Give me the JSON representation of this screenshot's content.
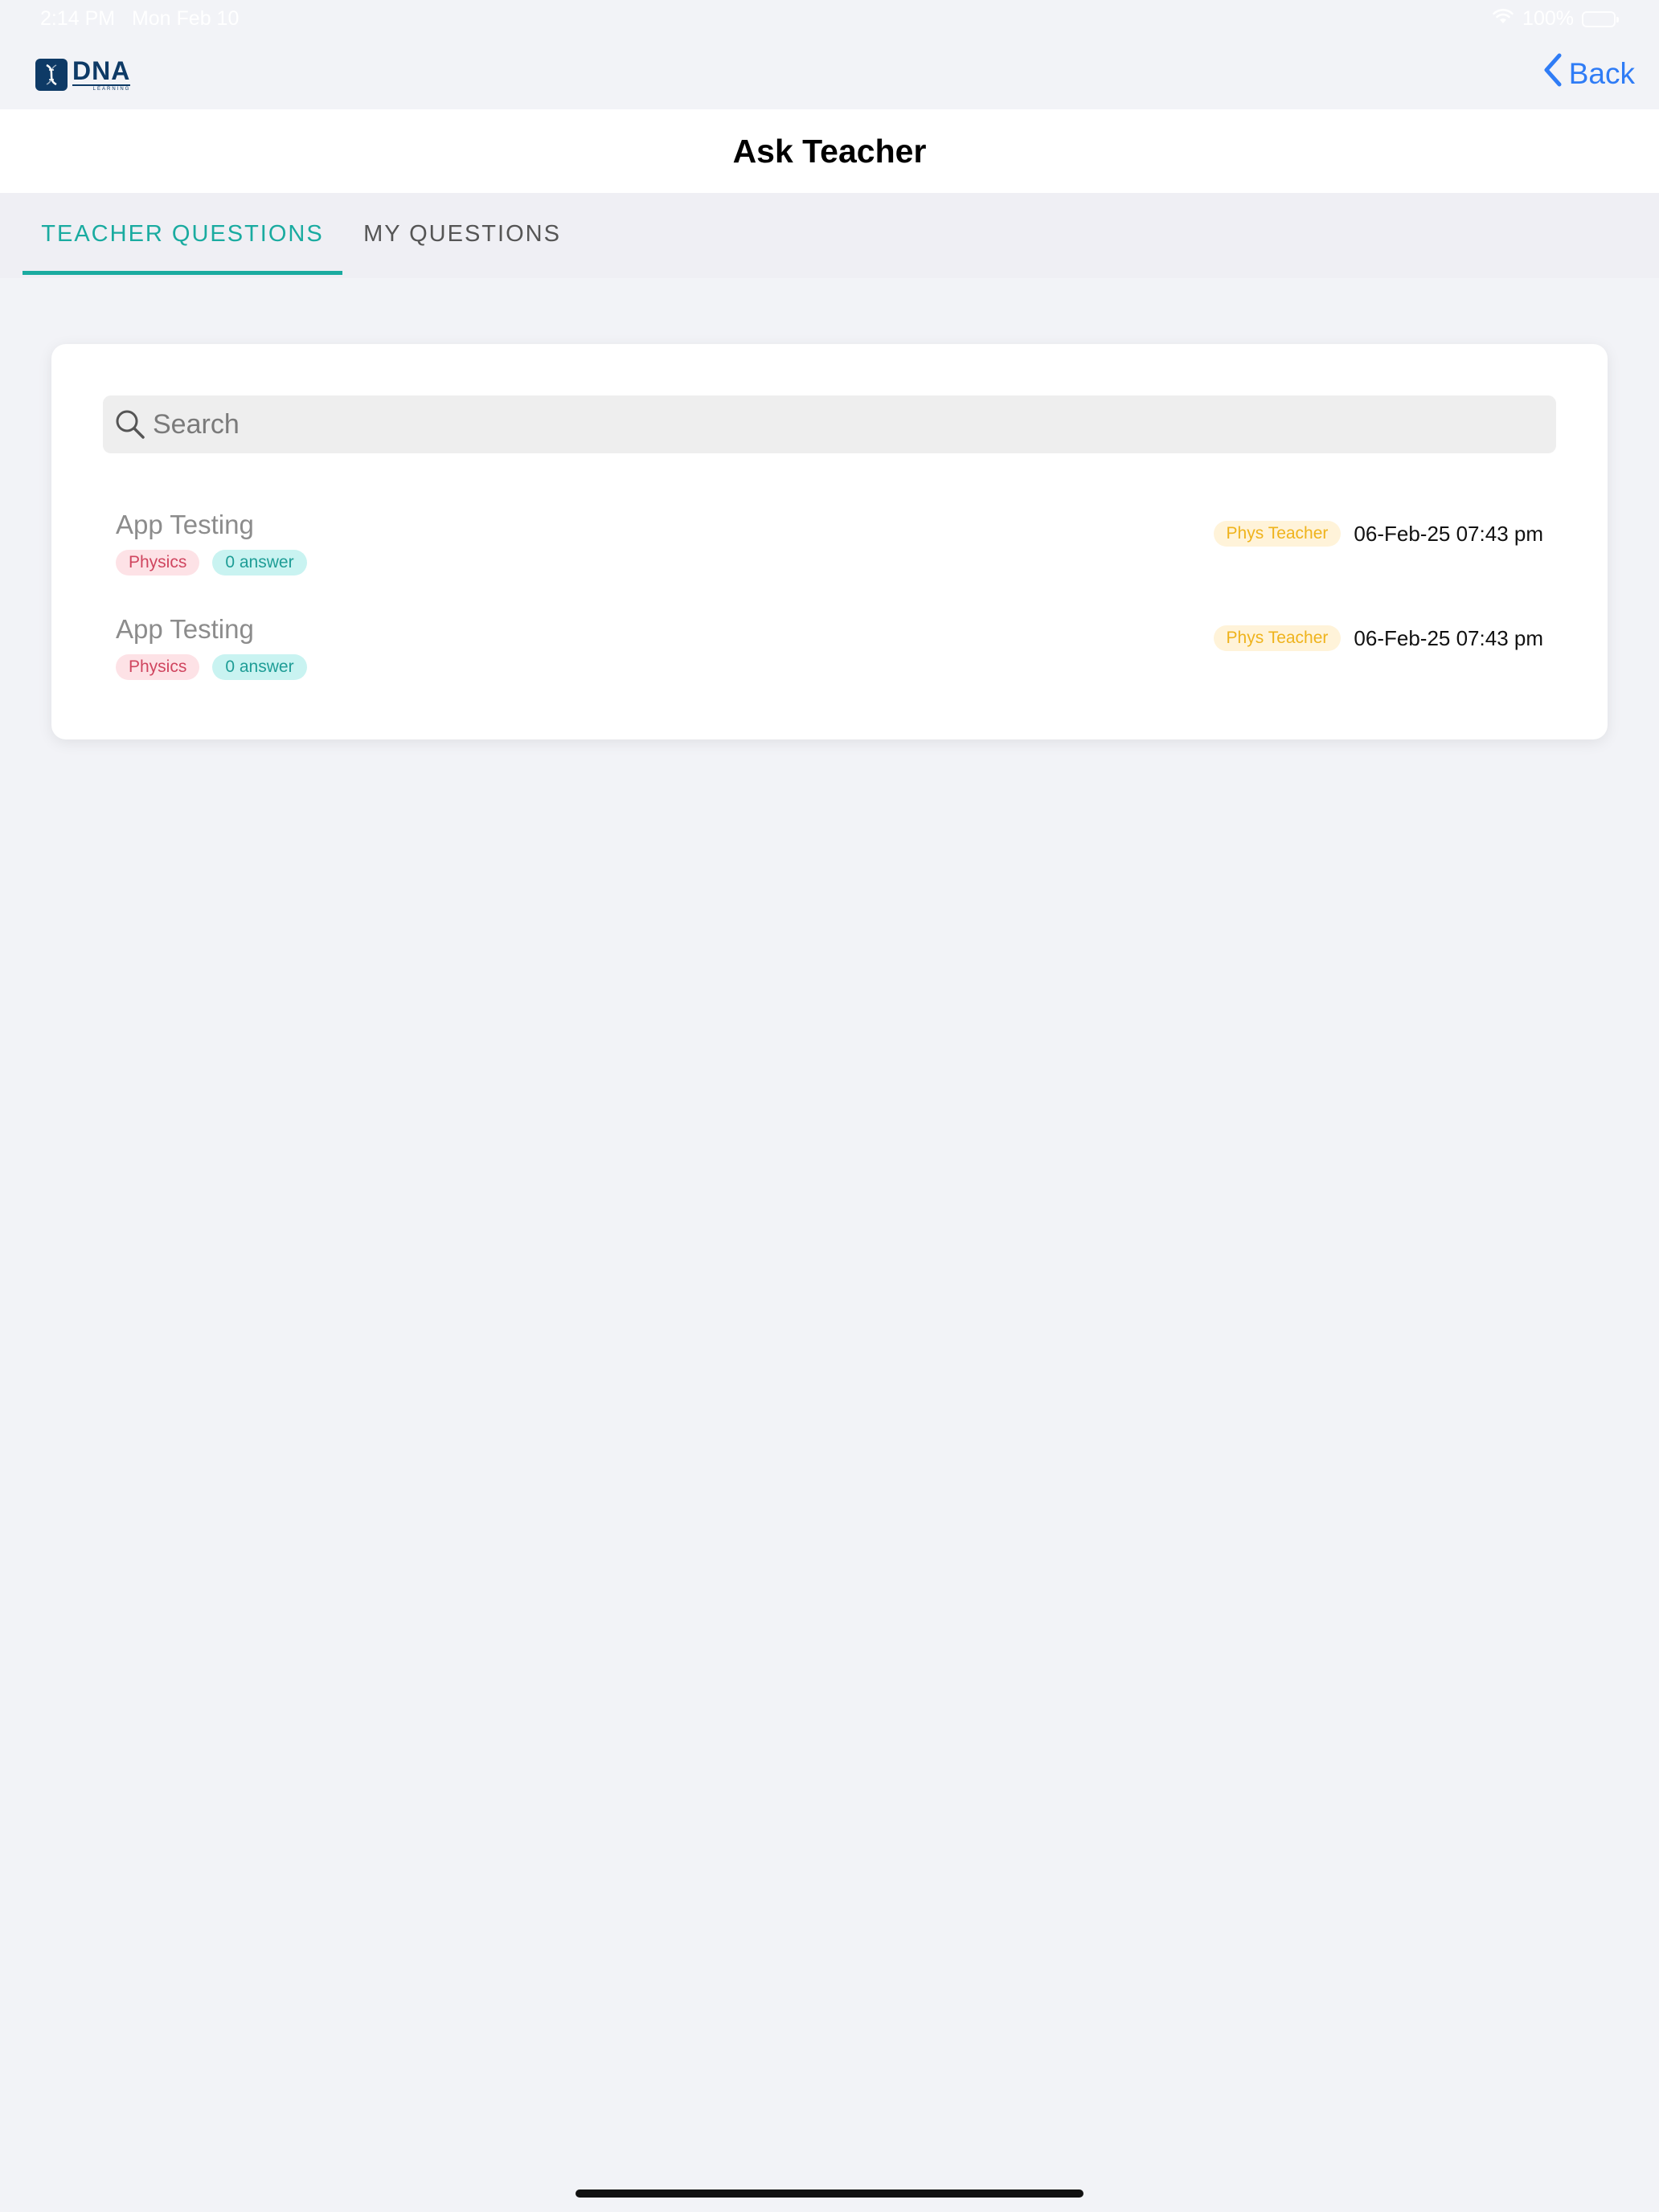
{
  "status_bar": {
    "time": "2:14 PM",
    "date": "Mon Feb 10",
    "battery": "100%"
  },
  "nav": {
    "logo_text": "DNA",
    "logo_subtext": "LEARNING",
    "back_label": "Back"
  },
  "page": {
    "title": "Ask Teacher"
  },
  "tabs": [
    {
      "label": "TEACHER QUESTIONS",
      "active": true
    },
    {
      "label": "MY QUESTIONS",
      "active": false
    }
  ],
  "search": {
    "placeholder": "Search",
    "value": ""
  },
  "questions": [
    {
      "title": "App Testing",
      "subject": "Physics",
      "answers": "0 answer",
      "teacher": "Phys Teacher",
      "datetime": "06-Feb-25 07:43 pm"
    },
    {
      "title": "App Testing",
      "subject": "Physics",
      "answers": "0 answer",
      "teacher": "Phys Teacher",
      "datetime": "06-Feb-25 07:43 pm"
    }
  ],
  "colors": {
    "accent": "#1aaba0",
    "link": "#2f7cf6",
    "brand": "#0e3a66"
  },
  "icons": {
    "back": "chevron-left-icon",
    "search": "search-icon",
    "wifi": "wifi-icon",
    "battery": "battery-icon",
    "logo": "dna-logo-icon"
  }
}
